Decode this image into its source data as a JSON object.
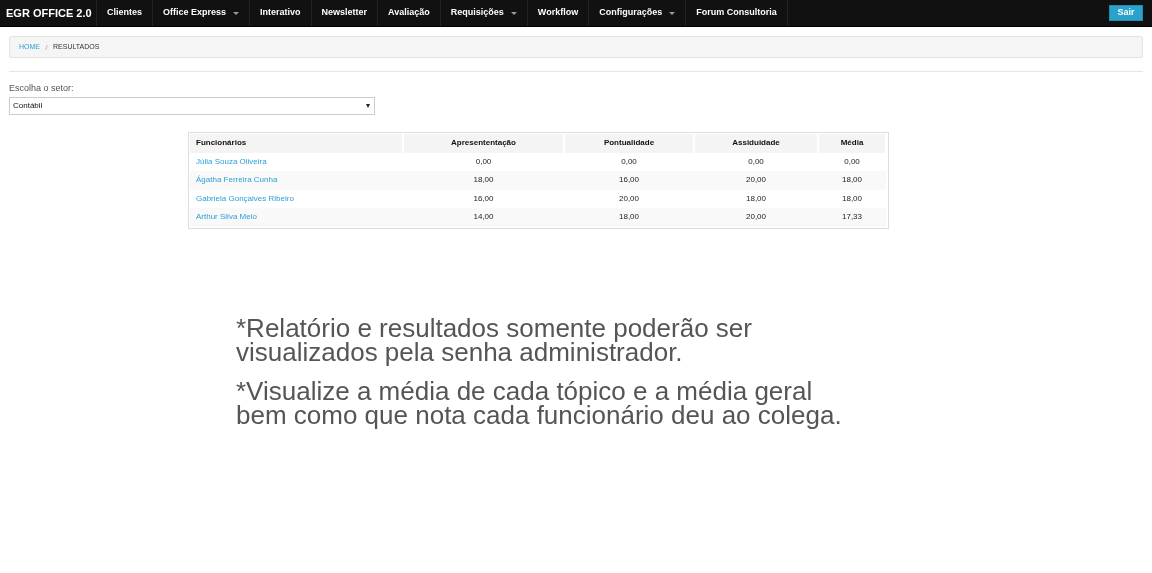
{
  "navbar": {
    "brand": "EGR OFFICE 2.0",
    "items": [
      {
        "label": "Clientes",
        "has_menu": false
      },
      {
        "label": "Office Express",
        "has_menu": true
      },
      {
        "label": "Interativo",
        "has_menu": false
      },
      {
        "label": "Newsletter",
        "has_menu": false
      },
      {
        "label": "Avaliação",
        "has_menu": false
      },
      {
        "label": "Requisições",
        "has_menu": true
      },
      {
        "label": "Workflow",
        "has_menu": false
      },
      {
        "label": "Configurações",
        "has_menu": true
      },
      {
        "label": "Forum Consultoria",
        "has_menu": false
      }
    ],
    "logout_button": "Sair"
  },
  "breadcrumb": [
    {
      "label": "HOME",
      "kind": "link"
    },
    {
      "label": "RESULTADOS",
      "kind": "current"
    }
  ],
  "sector_select": {
    "label": "Escolha o setor:",
    "value": "Contábil"
  },
  "table": {
    "columns": [
      "Funcionários",
      "Apresententação",
      "Pontualidade",
      "Assiduidade",
      "Média"
    ],
    "rows": [
      [
        "Júlia Souza Oliveira",
        "0,00",
        "0,00",
        "0,00",
        "0,00"
      ],
      [
        "Ágatha Ferreira Cunha",
        "18,00",
        "16,00",
        "20,00",
        "18,00"
      ],
      [
        "Gabriela Gonçalves Ribeiro",
        "16,00",
        "20,00",
        "18,00",
        "18,00"
      ],
      [
        "Arthur Silva Melo",
        "14,00",
        "18,00",
        "20,00",
        "17,33"
      ]
    ]
  },
  "notes": [
    "*Relatório e resultados somente poderão ser visualizados pela senha administrador.",
    "*Visualize a média de cada tópico e a média geral bem como que nota cada funcionário deu ao colega."
  ]
}
